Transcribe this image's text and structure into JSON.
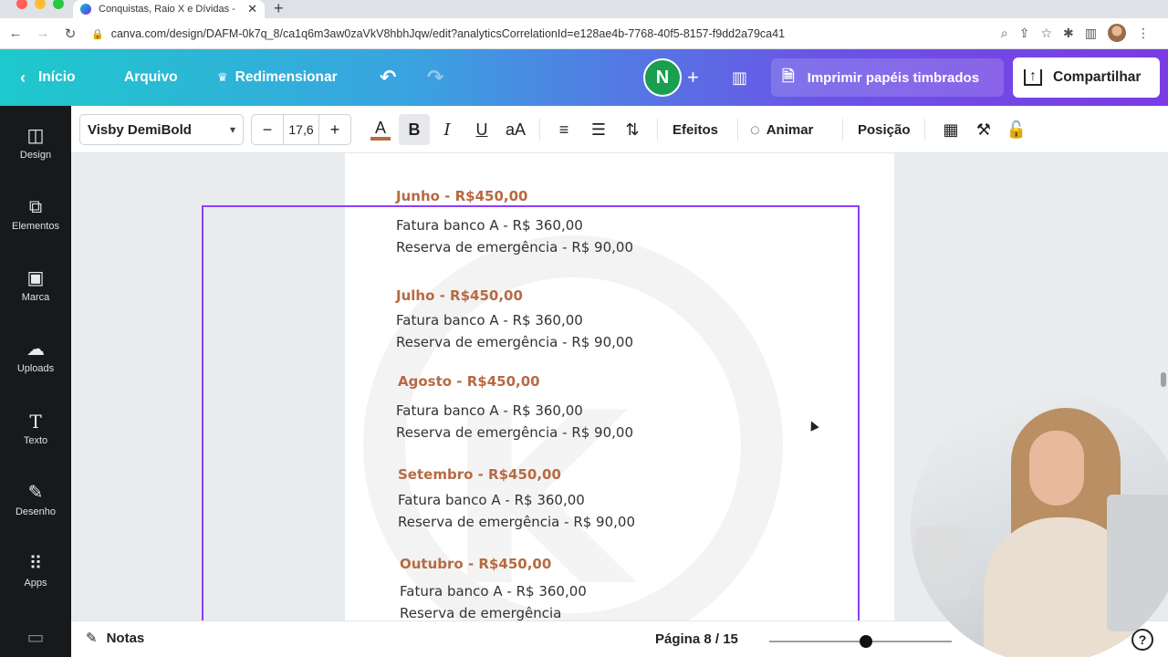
{
  "browser": {
    "tab_title": "Conquistas, Raio X e Dívidas -",
    "url": "canva.com/design/DAFM-0k7q_8/ca1q6m3aw0zaVkV8hbhJqw/edit?analyticsCorrelationId=e128ae4b-7768-40f5-8157-f9dd2a79ca41"
  },
  "topbar": {
    "home": "Início",
    "file": "Arquivo",
    "resize": "Redimensionar",
    "avatar_initial": "N",
    "print": "Imprimir papéis timbrados",
    "share": "Compartilhar",
    "colors": {
      "gradient_start": "#1ec9cc",
      "gradient_end": "#7b3be4",
      "avatar": "#1a9e50"
    }
  },
  "sidebar": {
    "items": [
      {
        "label": "Design",
        "icon": "layout-icon"
      },
      {
        "label": "Elementos",
        "icon": "shapes-icon"
      },
      {
        "label": "Marca",
        "icon": "brand-icon"
      },
      {
        "label": "Uploads",
        "icon": "cloud-upload-icon"
      },
      {
        "label": "Texto",
        "icon": "text-icon"
      },
      {
        "label": "Desenho",
        "icon": "draw-icon"
      },
      {
        "label": "Apps",
        "icon": "apps-grid-icon"
      }
    ]
  },
  "toolbar": {
    "font": "Visby DemiBold",
    "font_size": "17,6",
    "case_label": "aA",
    "effects": "Efeitos",
    "animate": "Animar",
    "position": "Posição"
  },
  "document": {
    "months": [
      {
        "title": "Junho -  R$450,00",
        "lines": [
          "Fatura banco A - R$ 360,00",
          "Reserva de emergência - R$ 90,00"
        ]
      },
      {
        "title": "Julho - R$450,00",
        "lines": [
          "Fatura banco A - R$ 360,00",
          "Reserva de emergência - R$ 90,00"
        ]
      },
      {
        "title": "Agosto - R$450,00",
        "lines": [
          "Fatura banco A - R$ 360,00",
          "Reserva de emergência - R$ 90,00"
        ]
      },
      {
        "title": "Setembro - R$450,00",
        "lines": [
          "Fatura banco A - R$ 360,00",
          "Reserva de emergência - R$ 90,00"
        ]
      },
      {
        "title": "Outubro - R$450,00",
        "lines": [
          "Fatura banco A - R$ 360,00",
          "Reserva de emergência"
        ]
      }
    ],
    "colors": {
      "month_title": "#b76a43",
      "body_text": "#333333",
      "selection": "#8b3dff"
    }
  },
  "bottombar": {
    "notes": "Notas",
    "page": "Página 8 / 15",
    "zoom_fraction": 0.53
  }
}
